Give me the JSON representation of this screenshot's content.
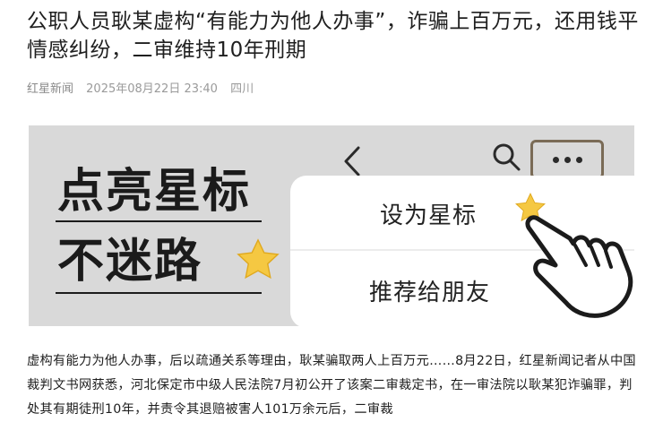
{
  "article": {
    "title": "公职人员耿某虚构“有能力为他人办事”，诈骗上百万元，还用钱平情感纠纷，二审维持10年刑期",
    "source": "红星新闻",
    "datetime": "2025年08月22日 23:40",
    "location": "四川",
    "body": "虚构有能力为他人办事，后以疏通关系等理由，耿某骗取两人上百万元……8月22日，红星新闻记者从中国裁判文书网获悉，河北保定市中级人民法院7月初公开了该案二审裁定书，在一审法院以耿某犯诈骗罪，判处其有期徒刑10年，并责令其退赔被害人101万余元后，二审裁"
  },
  "banner": {
    "slogan_line1": "点亮星标",
    "slogan_line2": "不迷路",
    "menu": {
      "item1": "设为星标",
      "item2": "推荐给朋友"
    },
    "colors": {
      "background": "#d9d9d9",
      "star": "#f5c842",
      "more_border": "#7a6b56"
    },
    "icons": [
      "back-chevron-icon",
      "search-icon",
      "more-dots-icon",
      "star-icon",
      "pointing-hand-icon"
    ]
  }
}
